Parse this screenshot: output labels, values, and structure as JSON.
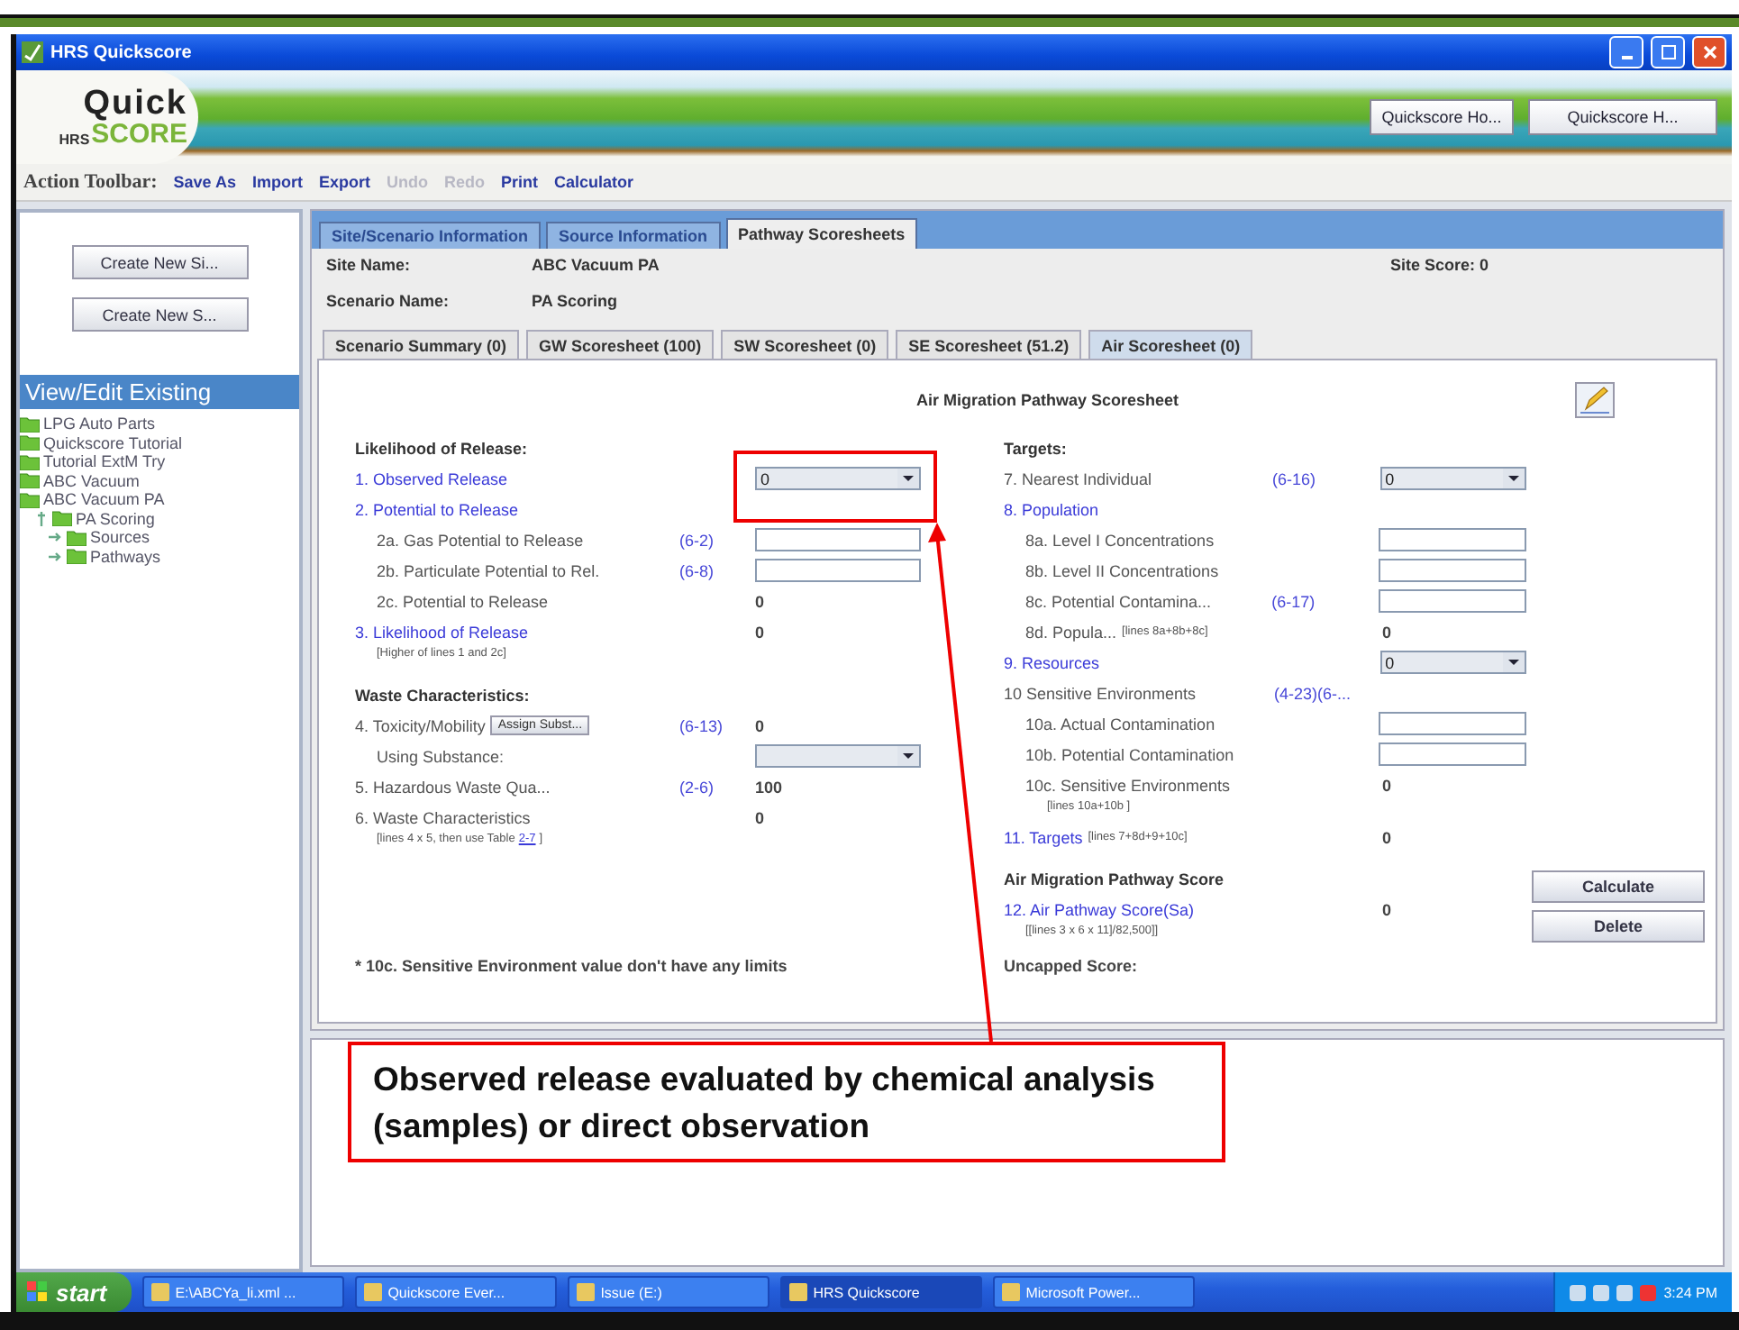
{
  "window": {
    "title": "HRS Quickscore"
  },
  "logo": {
    "top": "Quick",
    "left": "HRS",
    "bottom": "SCORE"
  },
  "banner_buttons": [
    "Quickscore Ho...",
    "Quickscore H..."
  ],
  "toolbar": {
    "label": "Action Toolbar:",
    "items": [
      {
        "label": "Save As",
        "disabled": false
      },
      {
        "label": "Import",
        "disabled": false
      },
      {
        "label": "Export",
        "disabled": false
      },
      {
        "label": "Undo",
        "disabled": true
      },
      {
        "label": "Redo",
        "disabled": true
      },
      {
        "label": "Print",
        "disabled": false
      },
      {
        "label": "Calculator",
        "disabled": false
      }
    ]
  },
  "sidebar": {
    "buttons": [
      "Create New Si...",
      "Create New S..."
    ],
    "section_title": "View/Edit Existing",
    "tree": [
      {
        "label": "LPG Auto Parts"
      },
      {
        "label": "Quickscore Tutorial"
      },
      {
        "label": "Tutorial ExtM Try"
      },
      {
        "label": "ABC Vacuum"
      },
      {
        "label": "ABC Vacuum PA",
        "children": [
          {
            "label": "PA Scoring",
            "expanded": true,
            "children": [
              {
                "label": "Sources",
                "expanded": false
              },
              {
                "label": "Pathways",
                "expanded": false
              }
            ]
          }
        ]
      }
    ]
  },
  "tabs": [
    {
      "label": "Site/Scenario Information",
      "selected": false
    },
    {
      "label": "Source Information",
      "selected": false
    },
    {
      "label": "Pathway Scoresheets",
      "selected": true
    }
  ],
  "site": {
    "name_label": "Site Name:",
    "name": "ABC Vacuum PA",
    "scenario_label": "Scenario Name:",
    "scenario": "PA Scoring",
    "score": "Site Score: 0"
  },
  "subtabs": [
    {
      "label": "Scenario Summary (0)",
      "selected": false
    },
    {
      "label": "GW Scoresheet (100)",
      "selected": false
    },
    {
      "label": "SW Scoresheet (0)",
      "selected": false
    },
    {
      "label": "SE Scoresheet (51.2)",
      "selected": false
    },
    {
      "label": "Air Scoresheet (0)",
      "selected": true
    }
  ],
  "sheet": {
    "title": "Air Migration Pathway Scoresheet",
    "left": [
      {
        "kind": "heading",
        "label": "Likelihood of Release:"
      },
      {
        "kind": "item",
        "label": "1. Observed Release",
        "link": true,
        "control": {
          "kind": "select",
          "value": "0"
        }
      },
      {
        "kind": "item",
        "label": "2. Potential to Release",
        "link": true,
        "children": [
          {
            "kind": "item",
            "label": "2a. Gas Potential to Release",
            "link": false,
            "range": "(6-2)",
            "control": {
              "kind": "input"
            }
          },
          {
            "kind": "item",
            "label": "2b. Particulate Potential to Rel.",
            "link": false,
            "range": "(6-8)",
            "control": {
              "kind": "input"
            }
          },
          {
            "kind": "item",
            "label": "2c. Potential to Release",
            "link": false,
            "control": {
              "kind": "value",
              "value": "0"
            }
          }
        ]
      },
      {
        "kind": "item",
        "label": "3. Likelihood of Release",
        "link": true,
        "control": {
          "kind": "value",
          "value": "0"
        },
        "note": "[Higher of lines 1 and 2c]"
      },
      {
        "kind": "heading",
        "label": "Waste Characteristics:"
      },
      {
        "kind": "item",
        "label": "4. Toxicity/Mobility",
        "link": false,
        "button": "Assign Subst...",
        "range": "(6-13)",
        "control": {
          "kind": "value",
          "value": "0"
        },
        "children": [
          {
            "kind": "item",
            "label": "Using Substance:",
            "link": false,
            "control": {
              "kind": "select"
            }
          }
        ]
      },
      {
        "kind": "item",
        "label": "5. Hazardous Waste Qua...",
        "link": false,
        "range": "(2-6)",
        "control": {
          "kind": "value",
          "value": "100"
        }
      },
      {
        "kind": "item",
        "label": "6. Waste Characteristics",
        "link": false,
        "control": {
          "kind": "value",
          "value": "0"
        },
        "note": "[lines 4 x 5, then use Table",
        "note_link": "2-7",
        "note_end": "]"
      }
    ],
    "right": [
      {
        "kind": "heading",
        "label": "Targets:"
      },
      {
        "kind": "item",
        "label": "7. Nearest Individual",
        "link": false,
        "range": "(6-16)",
        "control": {
          "kind": "select",
          "value": "0"
        }
      },
      {
        "kind": "item",
        "label": "8. Population",
        "link": true,
        "children": [
          {
            "kind": "item",
            "label": "8a. Level I Concentrations",
            "link": false,
            "control": {
              "kind": "input"
            }
          },
          {
            "kind": "item",
            "label": "8b. Level II Concentrations",
            "link": false,
            "control": {
              "kind": "input"
            }
          },
          {
            "kind": "item",
            "label": "8c. Potential Contamina...",
            "link": false,
            "range": "(6-17)",
            "control": {
              "kind": "input"
            }
          },
          {
            "kind": "item",
            "label": "8d. Popula...",
            "link": false,
            "inline_note": "[lines 8a+8b+8c]",
            "control": {
              "kind": "value",
              "value": "0"
            }
          }
        ]
      },
      {
        "kind": "item",
        "label": "9. Resources",
        "link": true,
        "control": {
          "kind": "select",
          "value": "0"
        }
      },
      {
        "kind": "item",
        "label": "10 Sensitive Environments",
        "link": false,
        "range": "(4-23)(6-...",
        "children": [
          {
            "kind": "item",
            "label": "10a. Actual Contamination",
            "link": false,
            "control": {
              "kind": "input"
            }
          },
          {
            "kind": "item",
            "label": "10b. Potential Contamination",
            "link": false,
            "control": {
              "kind": "input"
            }
          },
          {
            "kind": "item",
            "label": "10c. Sensitive Environments",
            "link": false,
            "control": {
              "kind": "value",
              "value": "0"
            },
            "note": "[lines 10a+10b ]"
          }
        ]
      },
      {
        "kind": "item",
        "label": "11. Targets",
        "link": true,
        "inline_note": "[lines 7+8d+9+10c]",
        "control": {
          "kind": "value",
          "value": "0"
        }
      },
      {
        "kind": "heading",
        "label": "Air Migration Pathway Score"
      },
      {
        "kind": "item",
        "label": "12. Air Pathway Score(Sa)",
        "link": true,
        "control": {
          "kind": "value",
          "value": "0"
        },
        "note": "[[lines 3 x 6 x 11]/82,500]]"
      }
    ],
    "footnote": "* 10c. Sensitive Environment value don't have any limits",
    "uncapped": "Uncapped Score:",
    "buttons": [
      "Calculate",
      "Delete"
    ]
  },
  "callout": "Observed release evaluated by chemical analysis (samples) or direct observation",
  "taskbar": {
    "start": "start",
    "items": [
      {
        "label": "E:\\ABCYa_li.xml ...",
        "selected": false
      },
      {
        "label": "Quickscore Ever...",
        "selected": false
      },
      {
        "label": "Issue (E:)",
        "selected": false
      },
      {
        "label": "HRS Quickscore",
        "selected": true
      },
      {
        "label": "Microsoft Power...",
        "selected": false
      }
    ],
    "clock": "3:24 PM"
  }
}
